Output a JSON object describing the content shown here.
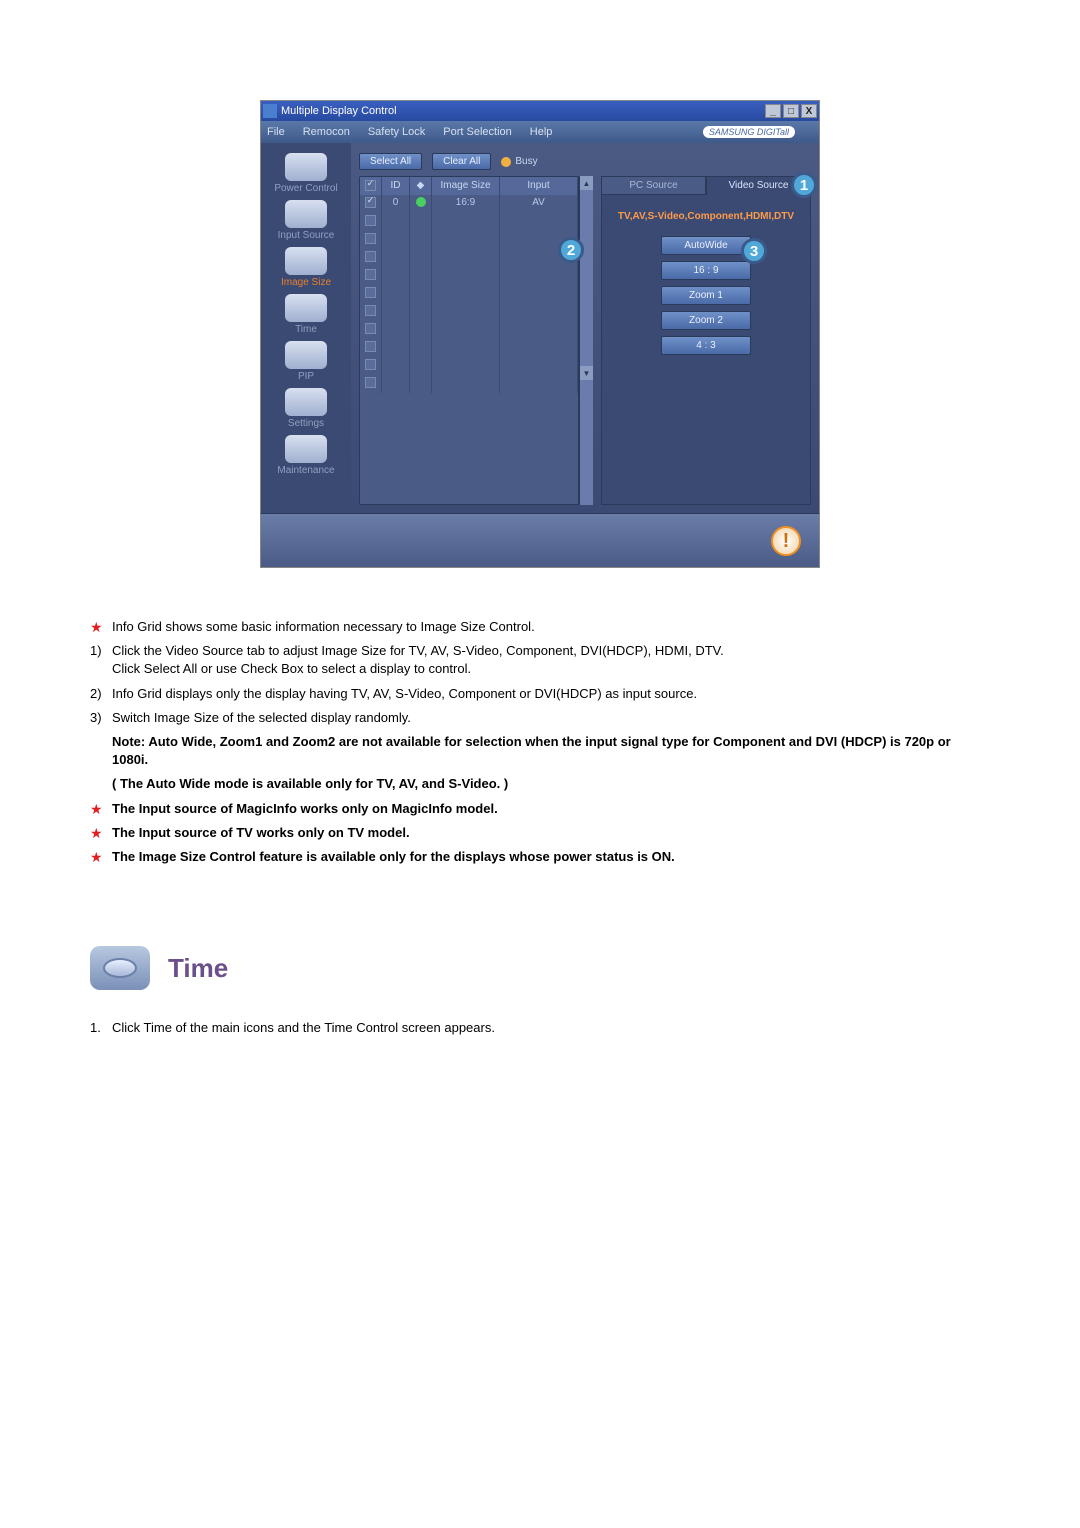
{
  "window": {
    "title": "Multiple Display Control",
    "menus": [
      "File",
      "Remocon",
      "Safety Lock",
      "Port Selection",
      "Help"
    ],
    "brand": "SAMSUNG DIGITall"
  },
  "sidebar": {
    "items": [
      {
        "label": "Power Control"
      },
      {
        "label": "Input Source"
      },
      {
        "label": "Image Size"
      },
      {
        "label": "Time"
      },
      {
        "label": "PIP"
      },
      {
        "label": "Settings"
      },
      {
        "label": "Maintenance"
      }
    ],
    "active_index": 2
  },
  "controls": {
    "select_all": "Select All",
    "clear_all": "Clear All",
    "busy": "Busy"
  },
  "grid": {
    "headers": {
      "id": "ID",
      "size": "Image Size",
      "input": "Input"
    },
    "rows": [
      {
        "checked": true,
        "id": "0",
        "status": "on",
        "size": "16:9",
        "input": "AV"
      },
      {
        "checked": false
      },
      {
        "checked": false
      },
      {
        "checked": false
      },
      {
        "checked": false
      },
      {
        "checked": false
      },
      {
        "checked": false
      },
      {
        "checked": false
      },
      {
        "checked": false
      },
      {
        "checked": false
      },
      {
        "checked": false
      }
    ]
  },
  "tabs": {
    "pc": "PC Source",
    "video": "Video Source",
    "active": "video"
  },
  "panel": {
    "label": "TV,AV,S-Video,Component,HDMI,DTV",
    "options": [
      "AutoWide",
      "16 : 9",
      "Zoom 1",
      "Zoom 2",
      "4 : 3"
    ]
  },
  "callouts": {
    "c1": "1",
    "c2": "2",
    "c3": "3"
  },
  "doc": {
    "lines": [
      {
        "type": "star",
        "text": "Info Grid shows some basic information necessary to Image Size Control."
      },
      {
        "type": "num",
        "n": "1)",
        "text": "Click the Video Source tab to adjust Image Size for TV, AV, S-Video, Component, DVI(HDCP), HDMI, DTV.",
        "text2": "Click Select All or use Check Box to select a display to control."
      },
      {
        "type": "num",
        "n": "2)",
        "text": "Info Grid displays only the display having TV, AV, S-Video, Component or DVI(HDCP) as input source."
      },
      {
        "type": "num",
        "n": "3)",
        "text": "Switch Image Size of the selected display randomly."
      },
      {
        "type": "note",
        "text": "Note: Auto Wide, Zoom1 and Zoom2 are not available for selection when the input signal type for Component and DVI (HDCP) is 720p or 1080i."
      },
      {
        "type": "note",
        "text": "( The Auto Wide mode is available only for TV, AV, and S-Video. )"
      },
      {
        "type": "starbold",
        "text": "The Input source of MagicInfo works only on MagicInfo model."
      },
      {
        "type": "starbold",
        "text": "The Input source of TV works only on TV model."
      },
      {
        "type": "starbold",
        "text": "The Image Size Control feature is available only for the displays whose power status is ON."
      }
    ]
  },
  "section2": {
    "heading": "Time",
    "step1": "Click Time of the main icons and the Time Control screen appears.",
    "step1_num": "1."
  }
}
